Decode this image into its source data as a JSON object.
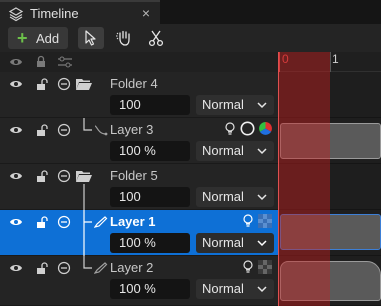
{
  "tab": {
    "title": "Timeline",
    "close": "×"
  },
  "toolbar": {
    "add_label": "Add",
    "add_symbol": "+"
  },
  "ruler": {
    "labels": [
      "0",
      "1"
    ]
  },
  "layers": [
    {
      "name": "Folder 4",
      "type": "folder",
      "opacity": "100",
      "blend": "Normal"
    },
    {
      "name": "Layer 3",
      "type": "layer",
      "opacity": "100 %",
      "blend": "Normal"
    },
    {
      "name": "Folder 5",
      "type": "folder",
      "opacity": "100",
      "blend": "Normal"
    },
    {
      "name": "Layer 1",
      "type": "layer",
      "opacity": "100 %",
      "blend": "Normal",
      "selected": true
    },
    {
      "name": "Layer 2",
      "type": "layer",
      "opacity": "100 %",
      "blend": "Normal"
    }
  ],
  "colors": {
    "selection": "#0e70d6",
    "playhead": "#c81e1e",
    "add_icon": "#6cc04a"
  }
}
